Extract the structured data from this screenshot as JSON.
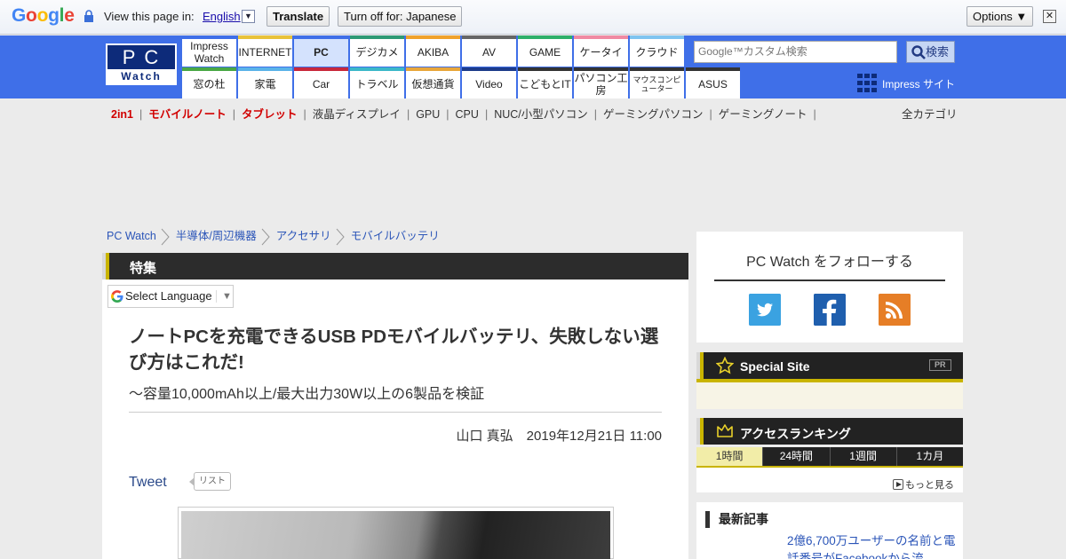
{
  "translate_bar": {
    "logo": "Google",
    "view_label": "View this page in:",
    "language": "English",
    "translate_button": "Translate",
    "turn_off_button": "Turn off for: Japanese",
    "options_button": "Options ▼",
    "close": "✕"
  },
  "header": {
    "logo_top": "PC",
    "logo_bottom": "Watch",
    "nav_top": [
      {
        "label": "Impress Watch",
        "color": "#3f6fe8"
      },
      {
        "label": "INTERNET",
        "color": "#e8c23a"
      },
      {
        "label": "PC",
        "color": "#3f6fe8"
      },
      {
        "label": "デジカメ",
        "color": "#2d9a76"
      },
      {
        "label": "AKIBA",
        "color": "#f0a22c"
      },
      {
        "label": "AV",
        "color": "#666666"
      },
      {
        "label": "GAME",
        "color": "#2fb06a"
      },
      {
        "label": "ケータイ",
        "color": "#f08aa3"
      },
      {
        "label": "クラウド",
        "color": "#7fc4f0"
      }
    ],
    "nav_bottom": [
      {
        "label": "窓の杜",
        "color": "#49a845"
      },
      {
        "label": "家電",
        "color": "#5ab3e8"
      },
      {
        "label": "Car",
        "color": "#c8283a"
      },
      {
        "label": "トラベル",
        "color": "#3bb8c8"
      },
      {
        "label": "仮想通貨",
        "color": "#e8a63a"
      },
      {
        "label": "Video",
        "color": "#1d3b8a"
      },
      {
        "label": "こどもとIT",
        "color": "#333333"
      },
      {
        "label": "パソコン工房",
        "color": "#333333"
      },
      {
        "label": "マウスコンピューター",
        "color": "#333333"
      },
      {
        "label": "ASUS",
        "color": "#333333"
      }
    ],
    "search_placeholder": "Google™カスタム検索",
    "search_button": "検索",
    "impress_link": "Impress サイト"
  },
  "categories": [
    "2in1",
    "モバイルノート",
    "タブレット",
    "液晶ディスプレイ",
    "GPU",
    "CPU",
    "NUC/小型パソコン",
    "ゲーミングパソコン",
    "ゲーミングノート"
  ],
  "all_categories": "全カテゴリ",
  "breadcrumb": [
    "PC Watch",
    "半導体/周辺機器",
    "アクセサリ",
    "モバイルバッテリ"
  ],
  "article": {
    "section": "特集",
    "select_language": "Select Language",
    "title": "ノートPCを充電できるUSB PDモバイルバッテリ、失敗しない選び方はこれだ!",
    "subtitle": "～容量10,000mAh以上/最大出力30W以上の6製品を検証",
    "byline": "山口 真弘　2019年12月21日 11:00",
    "tweet": "Tweet",
    "list": "リスト"
  },
  "sidebar": {
    "follow_title": "PC Watch をフォローする",
    "special_title": "Special Site",
    "pr": "PR",
    "ranking_title": "アクセスランキング",
    "ranking_tabs": [
      "1時間",
      "24時間",
      "1週間",
      "1カ月"
    ],
    "more": "もっと見る",
    "latest_title": "最新記事",
    "latest_item": "2億6,700万ユーザーの名前と電話番号がFacebookから流"
  }
}
